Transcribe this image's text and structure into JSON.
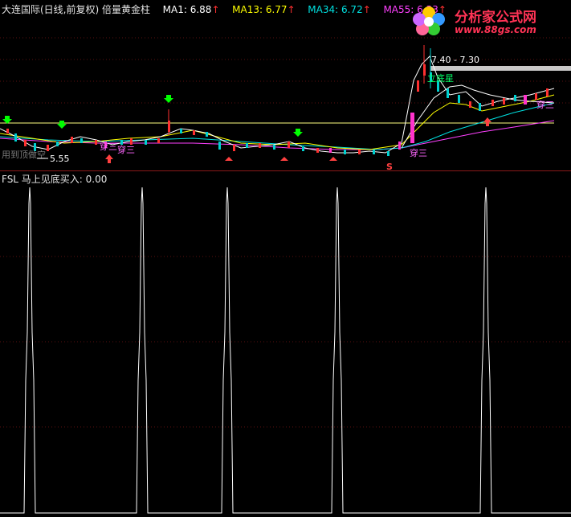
{
  "header": {
    "stock_title": "大连国际(日线,前复权) 倍量黄金柱",
    "ma1_label": "MA1: 6.88",
    "ma13_label": "MA13: 6.77",
    "ma34_label": "MA34: 6.72",
    "ma55_label": "MA55: 6.33",
    "up_arrow": "↑"
  },
  "indicator_header": {
    "label": "FSL  马上见底买入: 0.00"
  },
  "annotations": {
    "range_label": "7.40 - 7.30",
    "signal_left": "用到顶做空",
    "low_price": "5.55",
    "star_text": "立底星",
    "cross_text_1": "穿三",
    "cross_text_2": "穿三",
    "cross_text_3": "穿三",
    "cross_text_4": "穿三",
    "s_marker": "S"
  },
  "logo": {
    "title": "分析家公式网",
    "url": "www.88gs.com"
  },
  "colors": {
    "ma1": "#ffffff",
    "ma13": "#ffff00",
    "ma34": "#00e0e0",
    "ma55": "#ff40ff",
    "up_candle": "#ff3030",
    "down_candle": "#00d0d0",
    "arrow_green": "#00ff00",
    "arrow_red": "#ff4040",
    "magenta_bar": "#ff33cc"
  }
}
